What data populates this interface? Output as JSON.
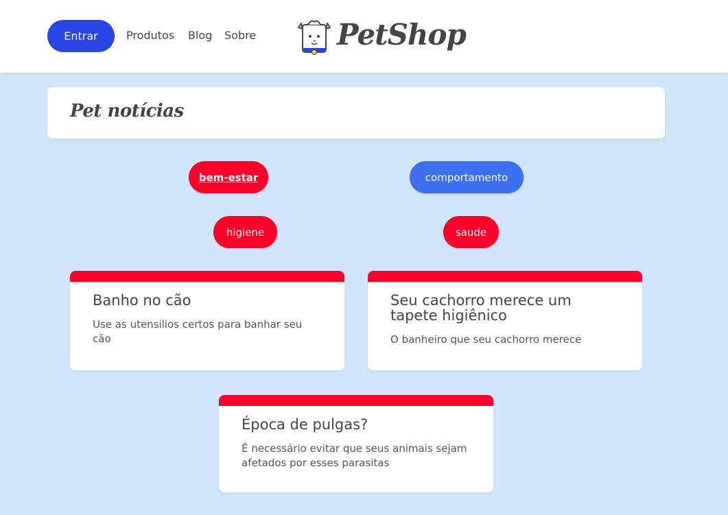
{
  "header": {
    "login_label": "Entrar",
    "nav": [
      "Produtos",
      "Blog",
      "Sobre"
    ],
    "logo_text": "PetShop"
  },
  "page_title": "Pet notícias",
  "tags": [
    {
      "label": "bem-estar",
      "color": "#ff0029",
      "active": true
    },
    {
      "label": "comportamento",
      "color": "#3a6ff0",
      "active": false
    },
    {
      "label": "higiene",
      "color": "#ff0029",
      "active": false
    },
    {
      "label": "saude",
      "color": "#ff0029",
      "active": false
    }
  ],
  "posts": [
    {
      "title": "Banho no cão",
      "summary": "Use as utensilios certos para banhar seu cão"
    },
    {
      "title": "Seu cachorro merece um tapete higiênico",
      "summary": "O banheiro que seu cachorro merece"
    },
    {
      "title": "Época de pulgas?",
      "summary": "É necessário evitar que seus animais sejam afetados por esses parasitas"
    }
  ],
  "colors": {
    "background": "#d1e5fd",
    "primary_blue": "#2845e6",
    "accent_red": "#ff0029",
    "tag_blue": "#3a6ff0"
  }
}
